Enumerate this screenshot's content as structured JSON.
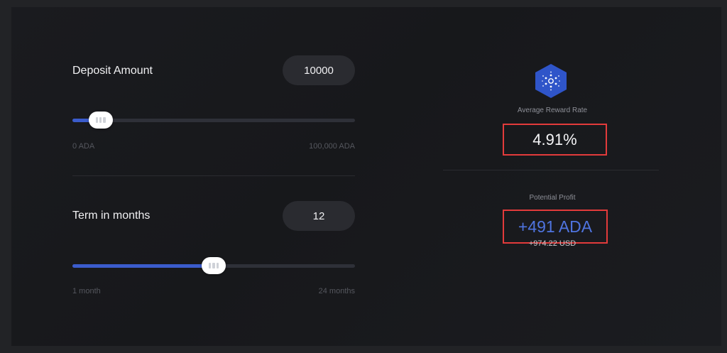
{
  "deposit": {
    "label": "Deposit Amount",
    "value": "10000",
    "slider_fraction": 0.1,
    "min_label": "0 ADA",
    "max_label": "100,000 ADA"
  },
  "term": {
    "label": "Term in months",
    "value": "12",
    "slider_fraction": 0.5,
    "min_label": "1 month",
    "max_label": "24 months"
  },
  "results": {
    "logo_icon": "cardano-hexagon-icon",
    "rate_caption": "Average Reward Rate",
    "rate_value": "4.91%",
    "profit_caption": "Potential Profit",
    "profit_value": "+491 ADA",
    "profit_usd": "+974.22 USD"
  },
  "colors": {
    "accent": "#3b5ccc",
    "profit": "#4f74e0",
    "highlight_box": "#e23b3b",
    "logo": "#2f55c9"
  }
}
